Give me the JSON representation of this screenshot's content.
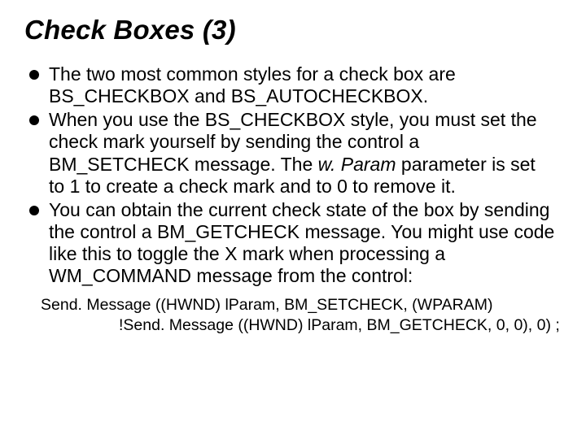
{
  "title": "Check Boxes (3)",
  "bullets": [
    "The two most common styles for a check box are BS_CHECKBOX and BS_AUTOCHECKBOX.",
    "When you use the BS_CHECKBOX style, you must set the check mark yourself by sending the control a BM_SETCHECK message. The ",
    "w. Param",
    " parameter is set to 1 to create a check mark and to 0 to remove it.",
    "You can obtain the current check state of the box by sending the control a BM_GETCHECK message. You might use code like this to toggle the X mark when processing a WM_COMMAND message from the control:"
  ],
  "code": {
    "line1": "Send. Message ((HWND) lParam, BM_SETCHECK, (WPARAM)",
    "line2": "!Send. Message ((HWND) lParam, BM_GETCHECK, 0, 0), 0) ;"
  }
}
